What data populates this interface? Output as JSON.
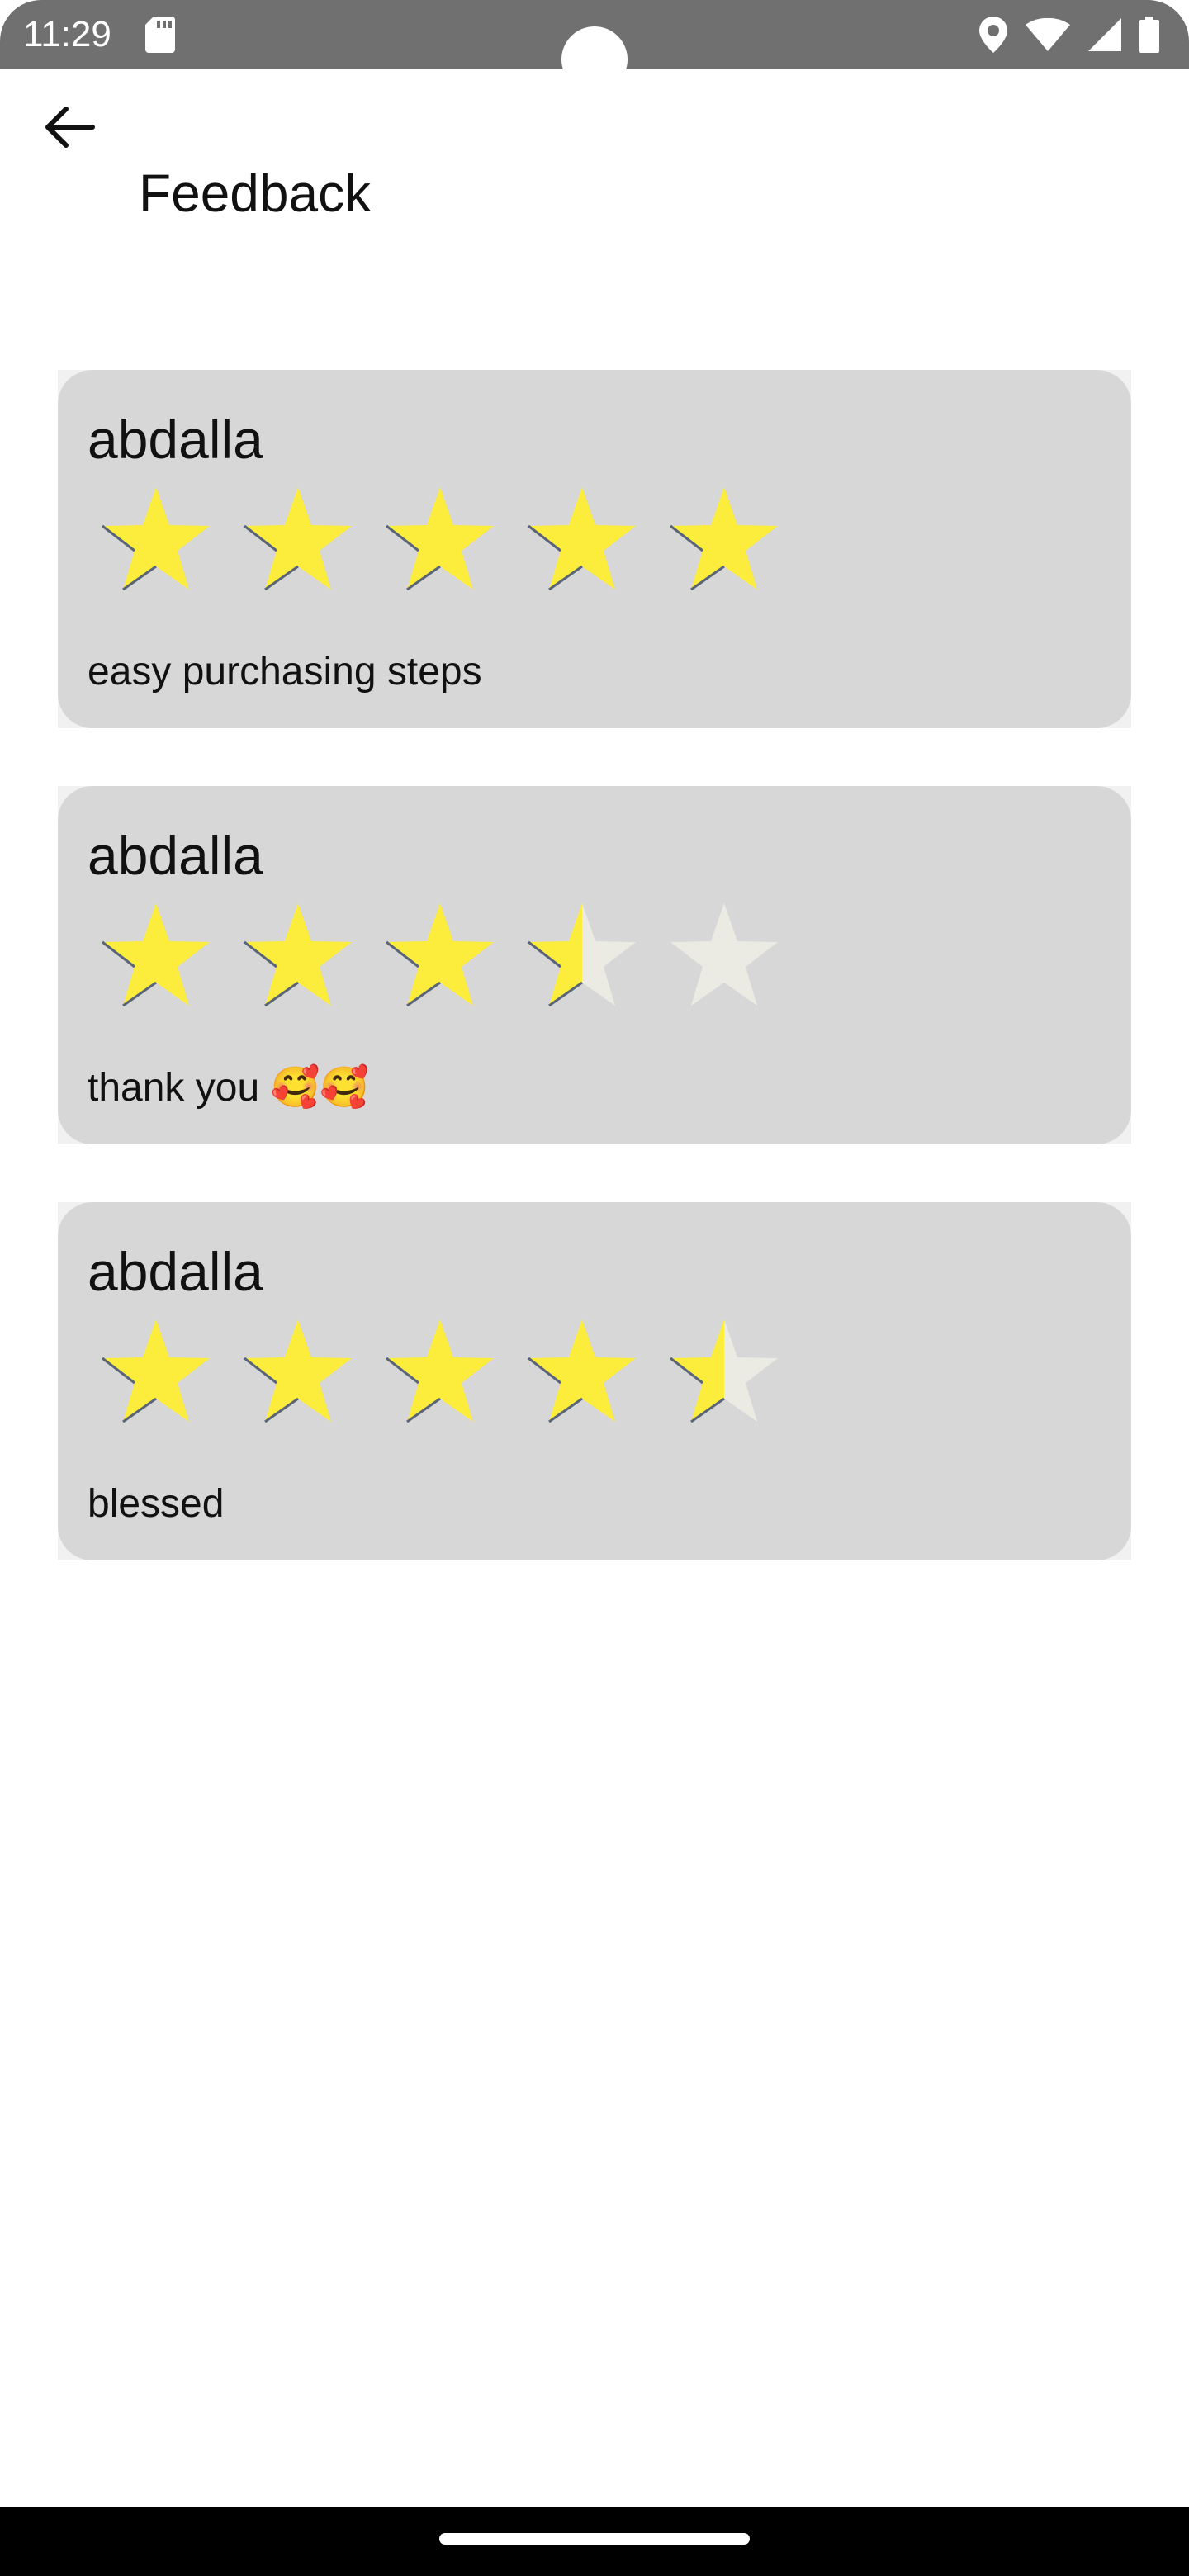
{
  "status_bar": {
    "time": "11:29",
    "icons": [
      "sd-card-icon",
      "location-icon",
      "wifi-icon",
      "signal-icon",
      "battery-icon"
    ]
  },
  "app_bar": {
    "back_icon": "arrow-back-icon",
    "title": "Feedback"
  },
  "colors": {
    "status_bar_bg": "#707070",
    "card_bg": "#d7d7d7",
    "star_filled": "#fcec3c",
    "star_empty": "#ebebe4",
    "star_shadow": "#5a6478"
  },
  "feedback": [
    {
      "name": "abdalla",
      "rating": 5,
      "comment": "easy purchasing steps"
    },
    {
      "name": "abdalla",
      "rating": 3.5,
      "comment": "thank you 🥰🥰"
    },
    {
      "name": "abdalla",
      "rating": 4.5,
      "comment": "blessed"
    }
  ],
  "rating_max": 5
}
